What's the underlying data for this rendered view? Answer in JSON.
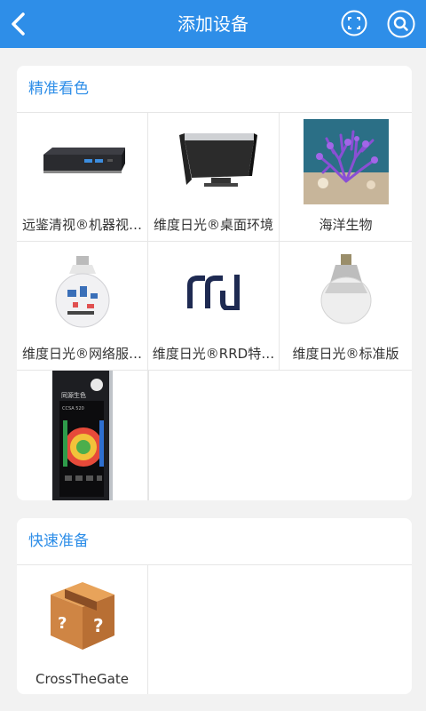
{
  "header": {
    "title": "添加设备",
    "back_icon": "back-chevron-icon",
    "scan_icon": "scan-icon",
    "search_icon": "search-icon",
    "color": "#2e8ee8"
  },
  "sections": [
    {
      "title": "精准看色",
      "items": [
        {
          "label": "远鉴清视®机器视…",
          "icon": "mini-pc-icon"
        },
        {
          "label": "维度日光®桌面环境",
          "icon": "monitor-hood-icon"
        },
        {
          "label": "海洋生物",
          "icon": "coral-photo-icon"
        },
        {
          "label": "维度日光®网络服…",
          "icon": "smart-bulb-icon"
        },
        {
          "label": "维度日光®RRD特…",
          "icon": "rrd-logo-icon"
        },
        {
          "label": "维度日光®标准版",
          "icon": "led-bulb-icon"
        },
        {
          "label": "",
          "icon": "colorimeter-device-icon",
          "brand_text": "同源生色",
          "screen_text": "CCSA 520"
        }
      ]
    },
    {
      "title": "快速准备",
      "items": [
        {
          "label": "CrossTheGate",
          "icon": "mystery-box-icon"
        }
      ]
    }
  ]
}
